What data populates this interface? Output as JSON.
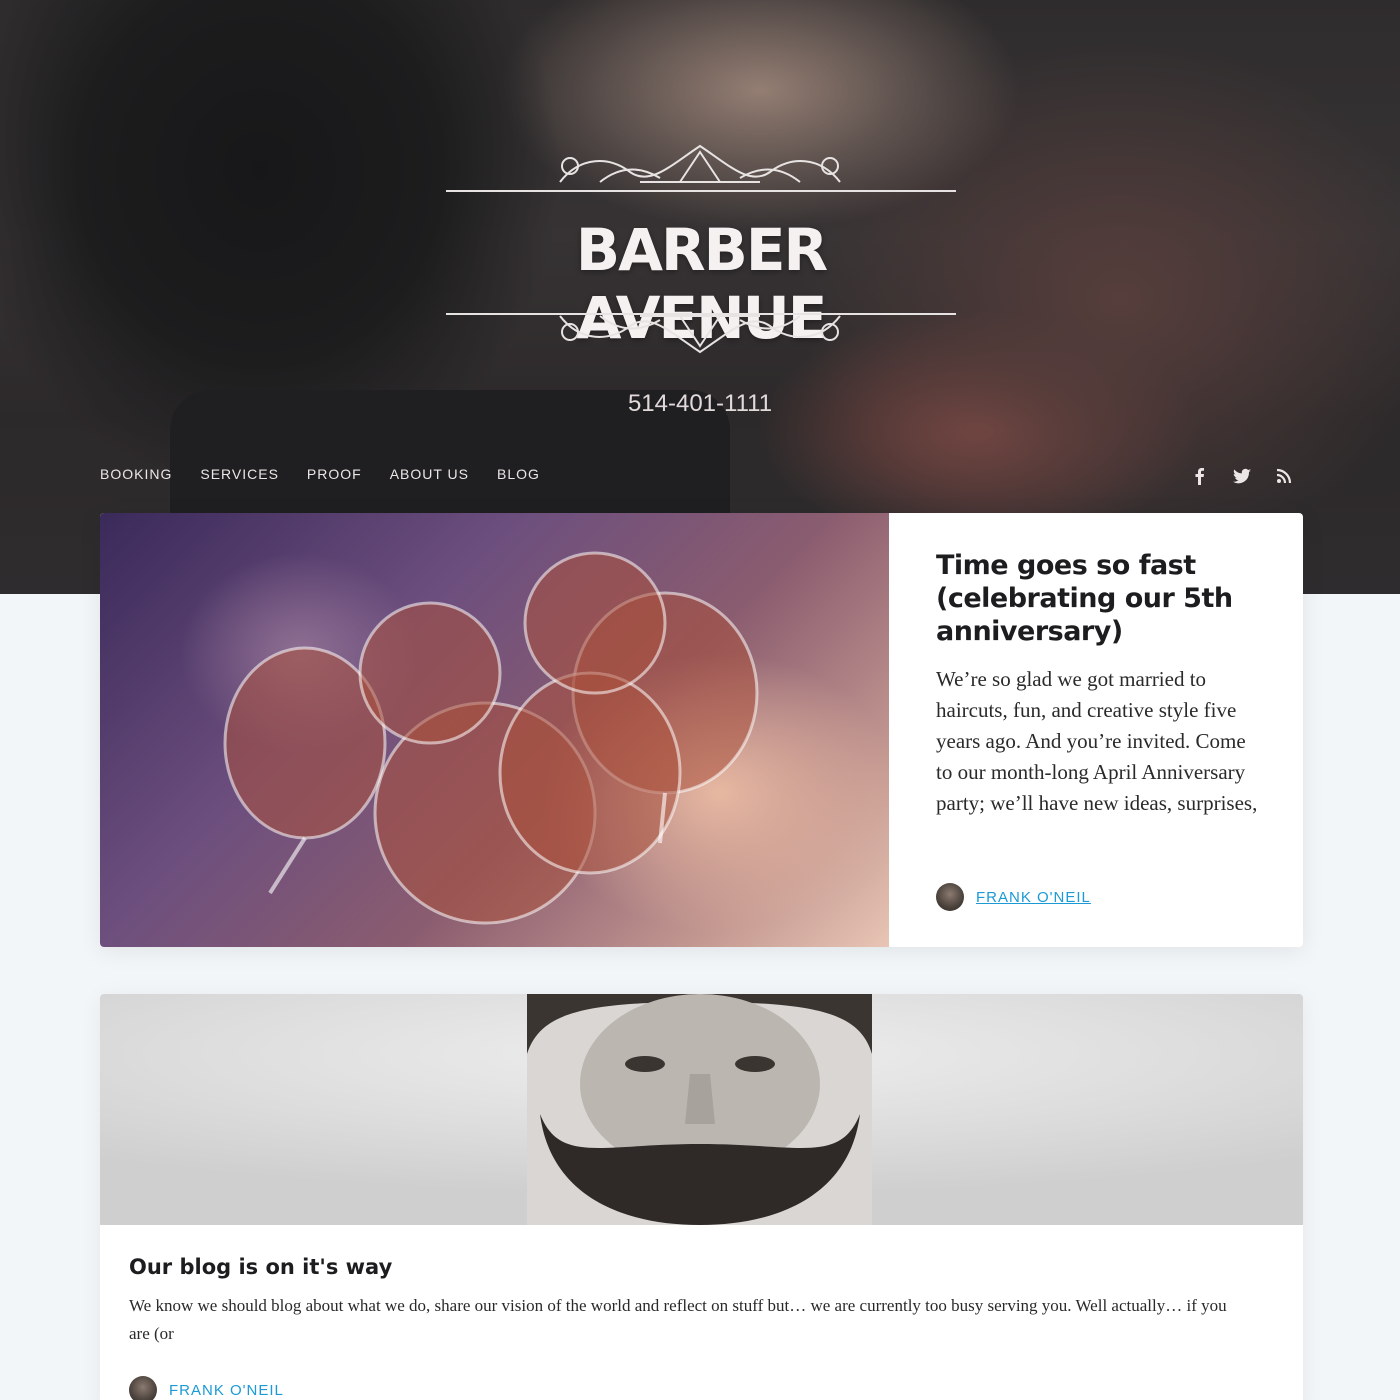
{
  "brand": {
    "name": "BARBER AVENUE",
    "phone": "514-401-1111"
  },
  "nav": {
    "items": [
      {
        "label": "BOOKING"
      },
      {
        "label": "SERVICES"
      },
      {
        "label": "PROOF"
      },
      {
        "label": "ABOUT US"
      },
      {
        "label": "BLOG"
      }
    ]
  },
  "social": {
    "icons": [
      "facebook-icon",
      "twitter-icon",
      "rss-icon"
    ]
  },
  "posts": [
    {
      "title": "Time goes so fast (celebrating our 5th anniversary)",
      "excerpt": "We’re so glad we got married to haircuts, fun, and creative style five years ago. And you’re invited. Come to our month-long April Anniversary party; we’ll have new ideas, surprises,",
      "author": "FRANK O'NEIL"
    },
    {
      "title": "Our blog is on it's way",
      "excerpt": "We know we should blog about what we do, share our vision of the world and reflect on stuff but… we are currently too busy serving you. Well actually… if you are (or",
      "author": "FRANK O'NEIL"
    }
  ],
  "colors": {
    "link": "#1b9ad6",
    "background": "#f3f6f9"
  }
}
